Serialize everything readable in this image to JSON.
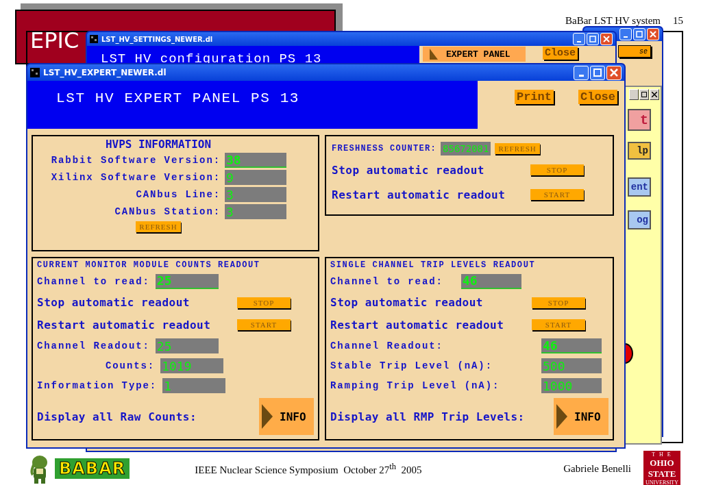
{
  "slide": {
    "title": "EPIC",
    "header": "BaBar LST HV system",
    "page": "15",
    "footer": "IEEE Nuclear Science Symposium  October 27$^{th}$  2005",
    "author": "Gabriele Benelli",
    "logo_text": "BABAR",
    "university": [
      "T H E",
      "OHIO",
      "STATE",
      "UNIVERSITY"
    ]
  },
  "side_window": {
    "close_label": "se",
    "buttons": [
      {
        "label": "t",
        "color": "#f0a0a0"
      },
      {
        "label": "lp",
        "color": "#f0c040"
      },
      {
        "label": "ent",
        "color": "#a8c8f0"
      },
      {
        "label": "og",
        "color": "#a8c8f0"
      }
    ]
  },
  "settings_window": {
    "title": "LST_HV_SETTINGS_NEWER.dl",
    "heading": "LST HV configuration PS 13",
    "buttons": [
      {
        "label": "EXPERT PANEL",
        "kind": "arrow"
      },
      {
        "label": "Close",
        "kind": "plain"
      }
    ]
  },
  "expert_window": {
    "title": "LST_HV_EXPERT_NEWER.dl",
    "heading": "LST HV EXPERT PANEL PS 13",
    "buttons": [
      "Print",
      "Close"
    ],
    "hvps": {
      "title": "HVPS INFORMATION",
      "button": "REFRESH",
      "fields": [
        {
          "label": "Rabbit Software Version:",
          "value": "38",
          "kind": "entry"
        },
        {
          "label": "Xilinx Software Version:",
          "value": "9",
          "kind": "readout"
        },
        {
          "label": "CANbus Line:",
          "value": "3",
          "kind": "readout"
        },
        {
          "label": "CANbus Station:",
          "value": "3",
          "kind": "readout"
        }
      ]
    },
    "freshness": {
      "label": "FRESHNESS COUNTER:",
      "value": "85672081",
      "button": "REFRESH",
      "rows": [
        {
          "label": "Stop automatic readout",
          "button": "STOP"
        },
        {
          "label": "Restart automatic readout",
          "button": "START"
        }
      ]
    },
    "panels": [
      {
        "title": "CURRENT MONITOR MODULE COUNTS READOUT",
        "rows": [
          {
            "kind": "entry",
            "label": "Channel to read:",
            "value": "25"
          },
          {
            "kind": "action",
            "label": "Stop automatic readout",
            "button": "STOP"
          },
          {
            "kind": "action",
            "label": "Restart automatic readout",
            "button": "START"
          },
          {
            "kind": "readout",
            "label": "Channel Readout:",
            "value": "25"
          },
          {
            "kind": "readout",
            "label": "Counts:",
            "value": "1019"
          },
          {
            "kind": "readout",
            "label": "Information Type:",
            "value": "1"
          },
          {
            "kind": "info",
            "label": "Display all Raw Counts:",
            "button": "INFO"
          }
        ]
      },
      {
        "title": "SINGLE CHANNEL TRIP LEVELS READOUT",
        "rows": [
          {
            "kind": "entry",
            "label": "Channel to read:",
            "value": "46"
          },
          {
            "kind": "action",
            "label": "Stop automatic readout",
            "button": "STOP"
          },
          {
            "kind": "action",
            "label": "Restart automatic readout",
            "button": "START"
          },
          {
            "kind": "entry",
            "label": "Channel Readout:",
            "value": "46"
          },
          {
            "kind": "readout",
            "label": "Stable Trip Level (nA):",
            "value": "500"
          },
          {
            "kind": "readout",
            "label": "Ramping Trip Level (nA):",
            "value": "1000"
          },
          {
            "kind": "info",
            "label": "Display all RMP Trip Levels:",
            "button": "INFO"
          }
        ]
      }
    ]
  }
}
